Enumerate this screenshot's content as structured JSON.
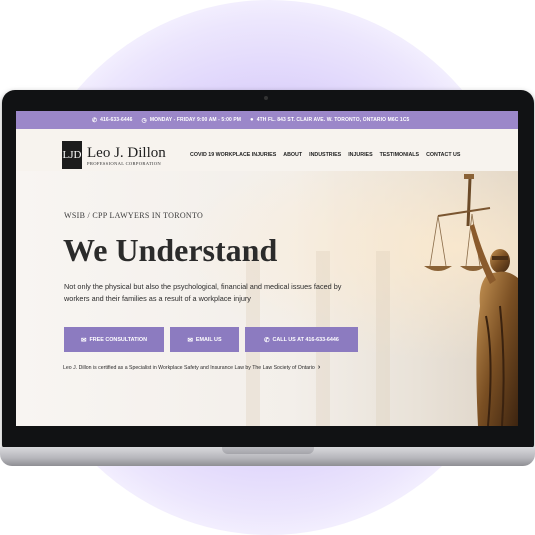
{
  "topbar": {
    "phone": "416-633-6446",
    "hours": "MONDAY - FRIDAY 9:00 AM - 5:00 PM",
    "address": "4TH FL. 843 ST. CLAIR AVE. W. TORONTO, ONTARIO M6C 1C5"
  },
  "logo": {
    "mark": "LJD",
    "name": "Leo J. Dillon",
    "subtitle": "PROFESSIONAL CORPORATION"
  },
  "nav": {
    "items": [
      {
        "label": "COVID 19 WORKPLACE INJURIES"
      },
      {
        "label": "ABOUT"
      },
      {
        "label": "INDUSTRIES"
      },
      {
        "label": "INJURIES"
      },
      {
        "label": "TESTIMONIALS"
      },
      {
        "label": "CONTACT US"
      }
    ]
  },
  "hero": {
    "kicker": "WSIB / CPP LAWYERS IN TORONTO",
    "headline": "We Understand",
    "description": "Not only the physical but also the psychological, financial and medical issues faced by workers and their families as a result of a workplace injury",
    "buttons": {
      "consult": "FREE CONSULTATION",
      "email": "EMAIL US",
      "call": "CALL US AT 416-633-6446"
    },
    "certification": "Leo J. Dillon is certified as a Specialist in Workplace Safety and Insurance Law by The Law Society of Ontario"
  },
  "colors": {
    "accent": "#9b87c9",
    "button": "#8c7bc0",
    "glow": "#c9b8f5"
  },
  "icons": {
    "phone": "phone-icon",
    "clock": "clock-icon",
    "location": "location-pin-icon",
    "chat": "chat-icon",
    "email": "envelope-icon",
    "chevron": "chevron-right-icon"
  }
}
